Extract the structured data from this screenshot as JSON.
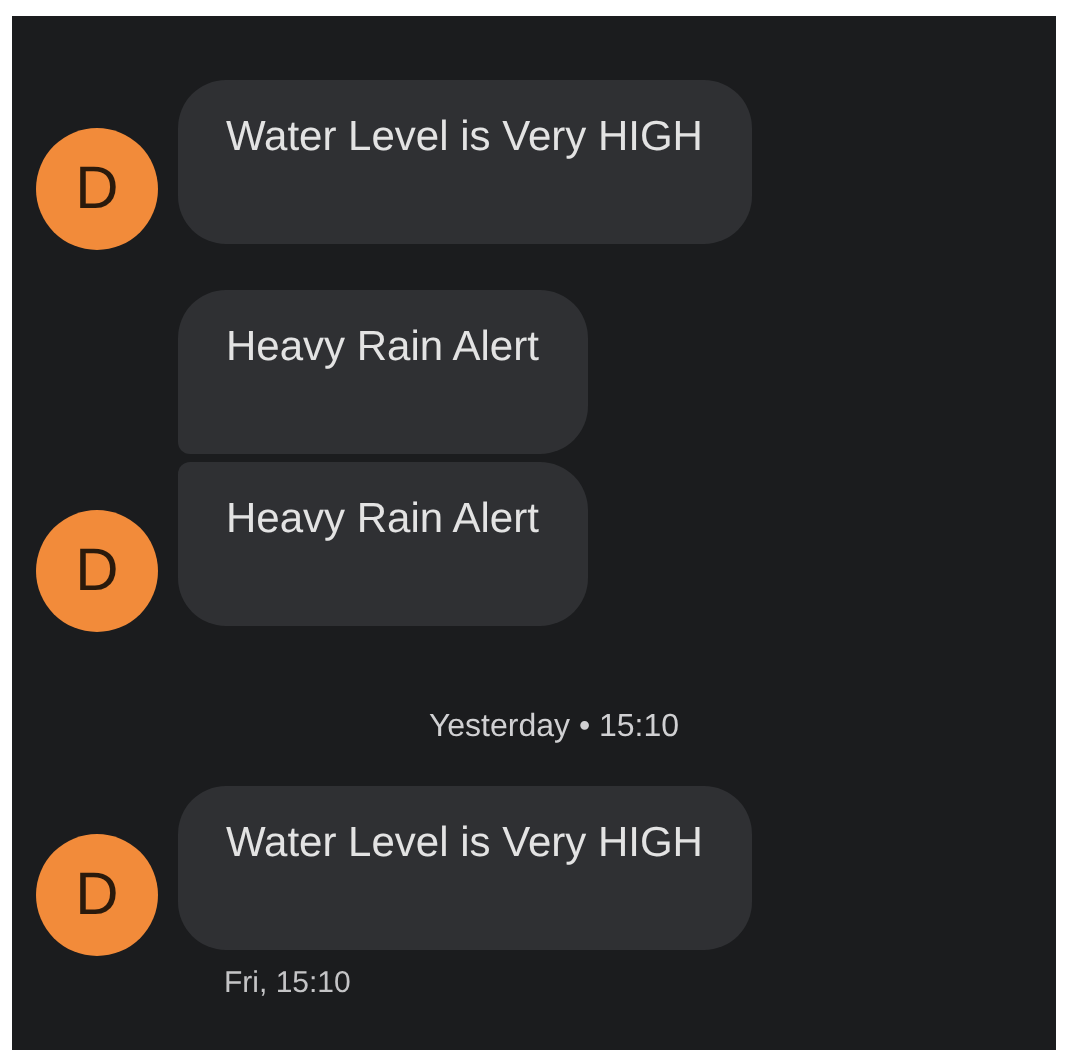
{
  "conversation": [
    {
      "kind": "group",
      "avatar": "D",
      "bubbles": [
        "Water Level is Very HIGH"
      ]
    },
    {
      "kind": "group",
      "avatar": "D",
      "bubbles": [
        "Heavy Rain Alert",
        "Heavy Rain Alert"
      ]
    },
    {
      "kind": "divider",
      "text": "Yesterday • 15:10"
    },
    {
      "kind": "group",
      "avatar": "D",
      "bubbles": [
        "Water Level is Very HIGH"
      ],
      "time": "Fri, 15:10"
    }
  ]
}
